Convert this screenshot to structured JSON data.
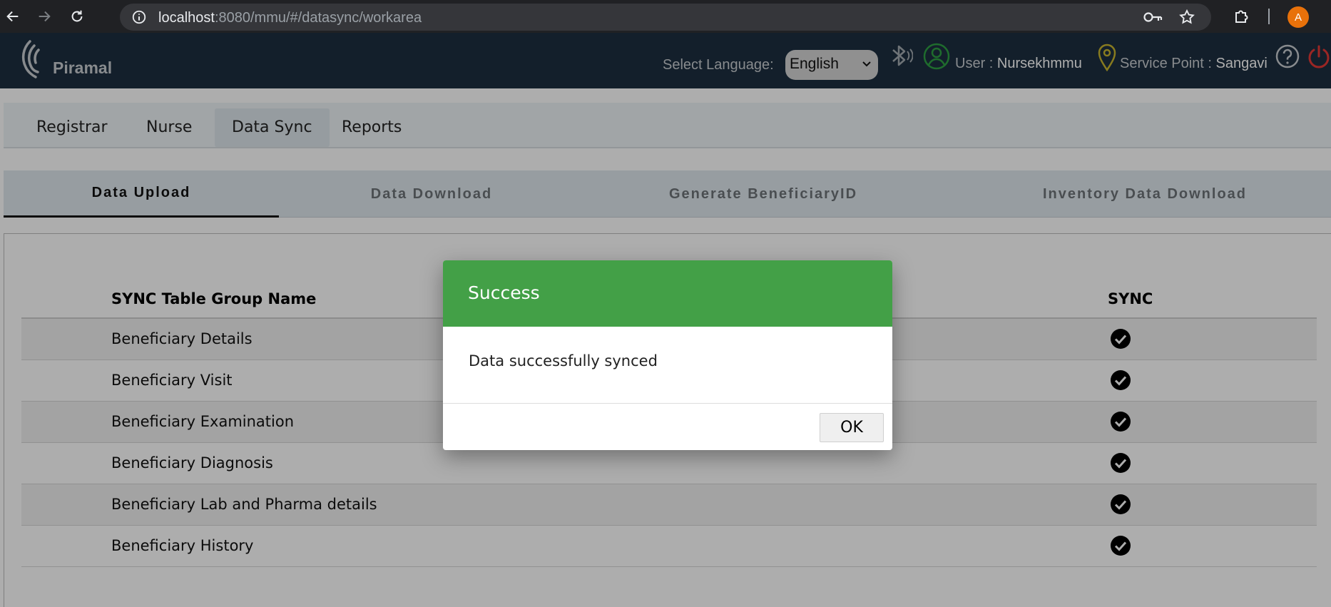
{
  "browser": {
    "url_host": "localhost",
    "url_path": ":8080/mmu/#/datasync/workarea",
    "avatar_letter": "A"
  },
  "app_header": {
    "logo_text": "Piramal",
    "select_language_label": "Select Language:",
    "language_value": "English",
    "user_label": "User : ",
    "user_value": "Nursekhmmu",
    "service_point_label": "Service Point : ",
    "service_point_value": "Sangavi"
  },
  "top_nav": {
    "items": [
      {
        "label": "Registrar"
      },
      {
        "label": "Nurse"
      },
      {
        "label": "Data Sync"
      },
      {
        "label": "Reports"
      }
    ],
    "active": "Data Sync"
  },
  "sub_tabs": {
    "items": [
      {
        "label": "Data Upload"
      },
      {
        "label": "Data Download"
      },
      {
        "label": "Generate BeneficiaryID"
      },
      {
        "label": "Inventory Data Download"
      }
    ],
    "active": "Data Upload"
  },
  "sync_table": {
    "headers": {
      "group_name": "SYNC Table Group Name",
      "sync": "SYNC"
    },
    "rows": [
      {
        "label": "Beneficiary Details"
      },
      {
        "label": "Beneficiary Visit"
      },
      {
        "label": "Beneficiary Examination"
      },
      {
        "label": "Beneficiary Diagnosis"
      },
      {
        "label": "Beneficiary Lab and Pharma details"
      },
      {
        "label": "Beneficiary History"
      }
    ]
  },
  "dialog": {
    "title": "Success",
    "message": "Data successfully synced",
    "ok_label": "OK"
  },
  "colors": {
    "dialog_header": "#43a047",
    "app_header": "#1c2f40",
    "power_icon": "#e53935",
    "user_icon": "#2ea043",
    "location_icon": "#c9b52f"
  }
}
